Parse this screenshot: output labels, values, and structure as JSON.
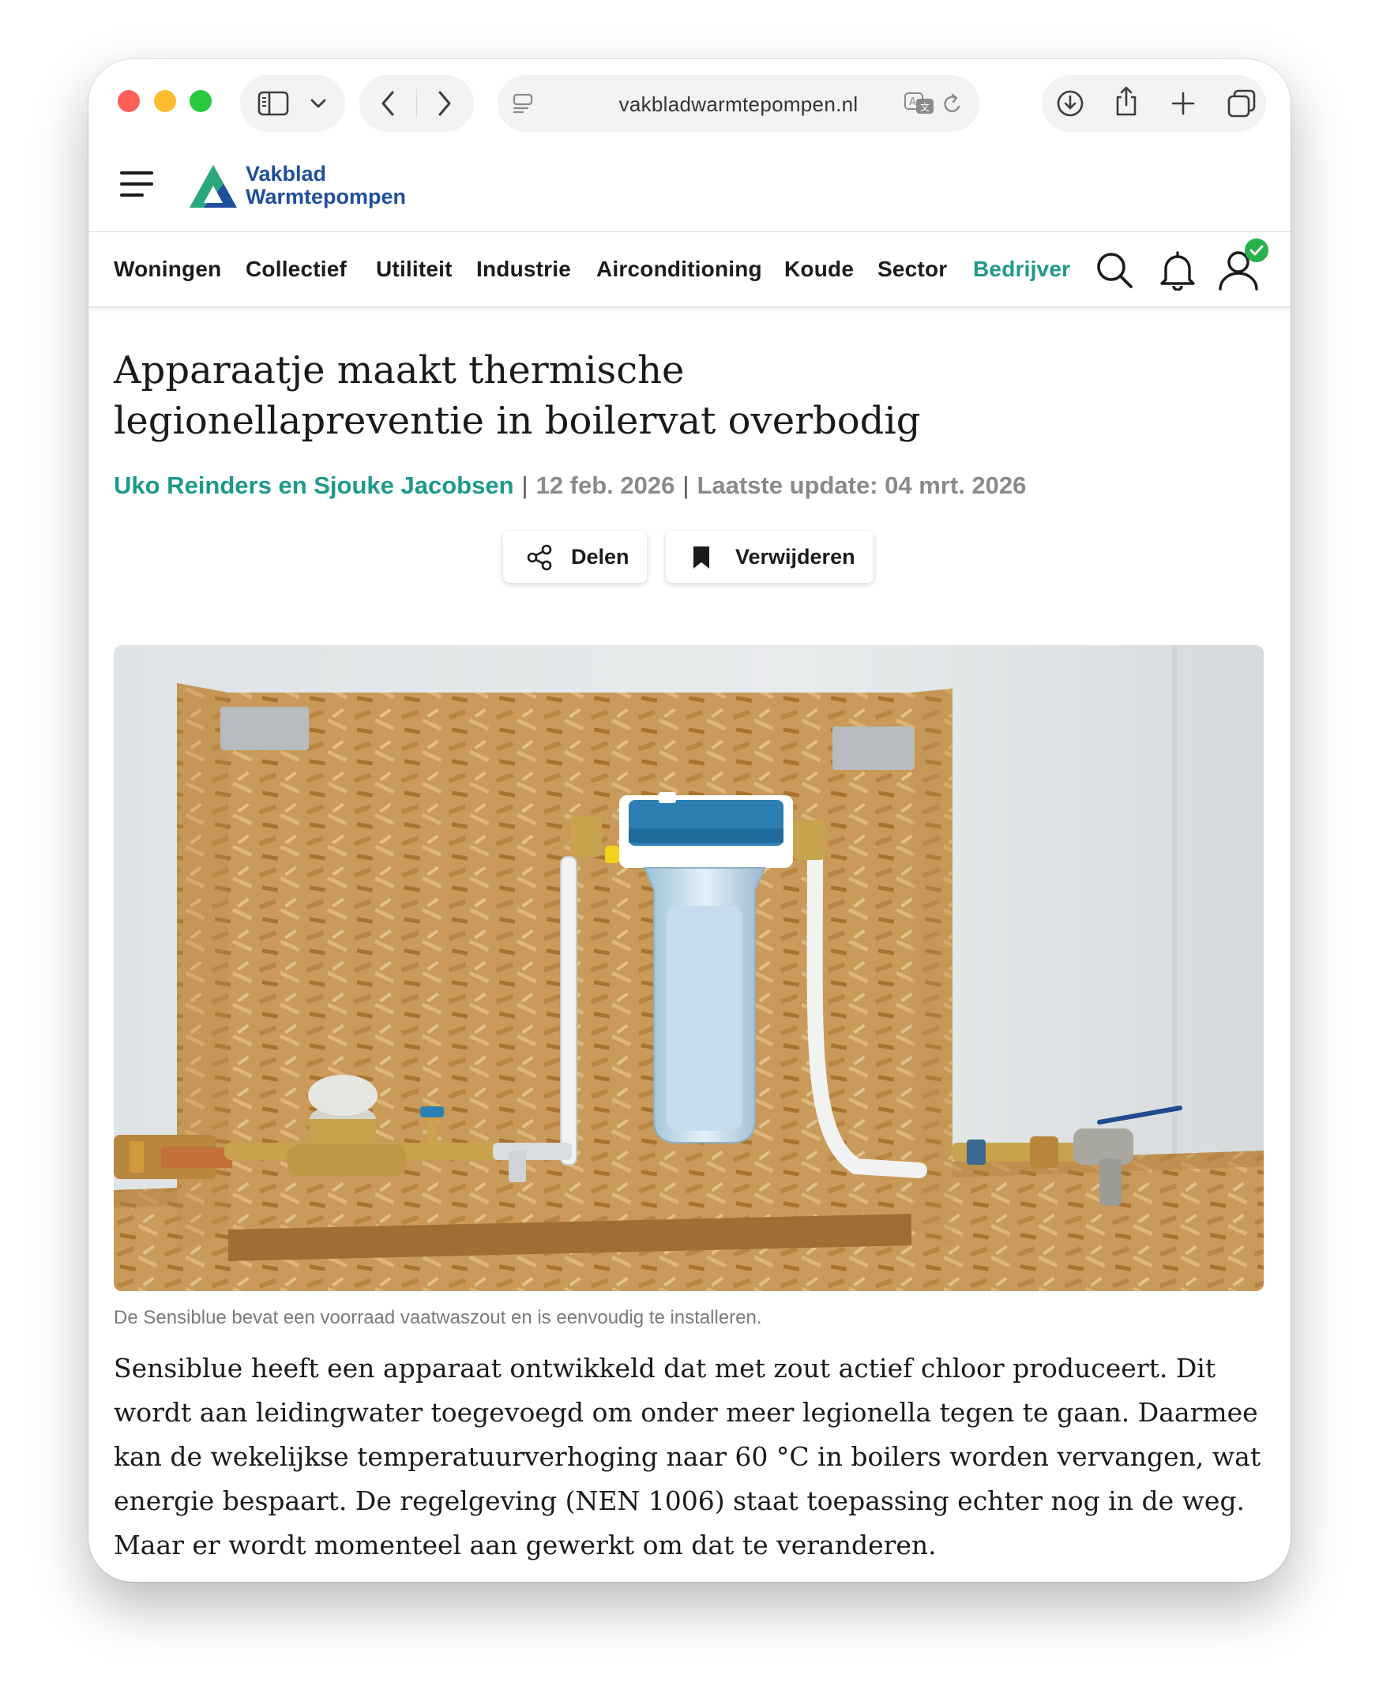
{
  "browser": {
    "url": "vakbladwarmtepompen.nl"
  },
  "site": {
    "logo_line1": "Vakblad",
    "logo_line2": "Warmtepompen",
    "brand_color": "#1f4e9c",
    "accent_color": "#1c9a8b"
  },
  "nav": {
    "items": [
      "Woningen",
      "Collectief",
      "Utiliteit",
      "Industrie",
      "Airconditioning",
      "Koude",
      "Sector",
      "Bedrijver"
    ]
  },
  "article": {
    "title_line1": "Apparaatje maakt thermische",
    "title_line2": "legionellapreventie in boilervat overbodig",
    "authors": "Uko Reinders en Sjouke Jacobsen",
    "sep1": "|",
    "date": "12 feb. 2026",
    "sep2": "|",
    "updated": "Laatste update: 04 mrt. 2026",
    "share_label": "Delen",
    "remove_label": "Verwijderen",
    "image_caption": "De Sensiblue bevat een voorraad vaatwaszout en is eenvoudig te installeren.",
    "body": "Sensiblue heeft een apparaat ontwikkeld dat met zout actief chloor produceert. Dit wordt aan leidingwater toegevoegd om onder meer legionella tegen te gaan. Daarmee kan de wekelijkse temperatuurverhoging naar 60 °C in boilers worden vervangen, wat energie bespaart. De regelgeving (NEN 1006) staat toepassing echter nog in de weg. Maar er wordt momenteel aan gewerkt om dat te veranderen."
  }
}
